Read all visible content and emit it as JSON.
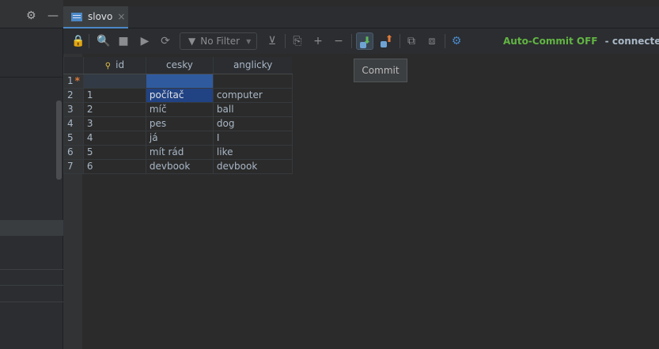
{
  "tab": {
    "title": "slovo",
    "close": "×"
  },
  "toolbar": {
    "filter_label": "No Filter",
    "autocommit_label": "Auto-Commit OFF",
    "connection_status": "- connected"
  },
  "tooltip": {
    "text": "Commit"
  },
  "table": {
    "columns": [
      "id",
      "cesky",
      "anglicky"
    ],
    "rows": [
      {
        "num": "1",
        "marker": "*",
        "id": "",
        "cesky": "",
        "anglicky": ""
      },
      {
        "num": "2",
        "id": "1",
        "cesky": "počítač",
        "anglicky": "computer"
      },
      {
        "num": "3",
        "id": "2",
        "cesky": "míč",
        "anglicky": "ball"
      },
      {
        "num": "4",
        "id": "3",
        "cesky": "pes",
        "anglicky": "dog"
      },
      {
        "num": "5",
        "id": "4",
        "cesky": "já",
        "anglicky": "I"
      },
      {
        "num": "6",
        "id": "5",
        "cesky": "mít rád",
        "anglicky": "like"
      },
      {
        "num": "7",
        "id": "6",
        "cesky": "devbook",
        "anglicky": "devbook"
      }
    ]
  },
  "colors": {
    "accent": "#4a88c7",
    "autocommit": "#62b543",
    "selection": "#214283"
  }
}
